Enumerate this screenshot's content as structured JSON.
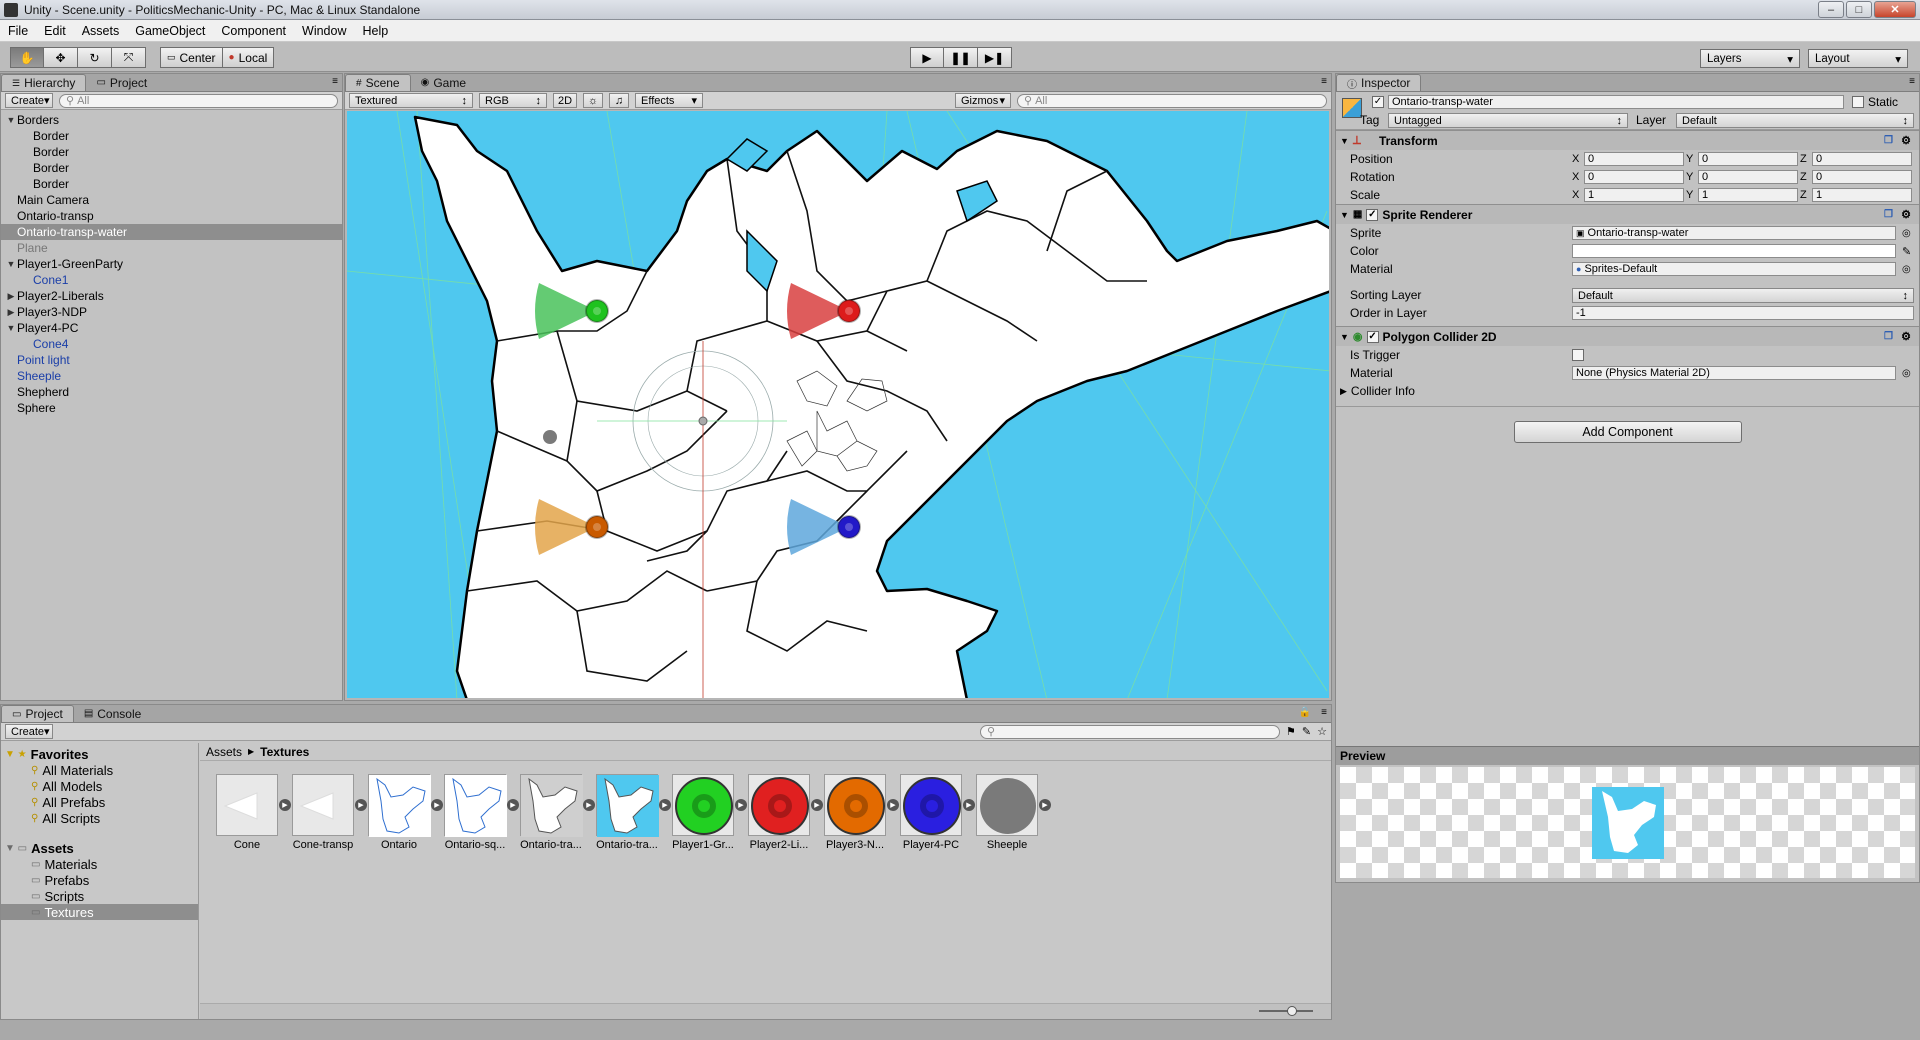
{
  "window": {
    "title": "Unity - Scene.unity - PoliticsMechanic-Unity - PC, Mac & Linux Standalone",
    "min": "–",
    "max": "□",
    "close": "✕"
  },
  "menu": [
    "File",
    "Edit",
    "Assets",
    "GameObject",
    "Component",
    "Window",
    "Help"
  ],
  "toolbar": {
    "pivot": "Center",
    "space": "Local",
    "layers": "Layers",
    "layout": "Layout"
  },
  "hierarchy": {
    "tabs": [
      "Hierarchy",
      "Project"
    ],
    "create": "Create",
    "search_placeholder": "All",
    "items": [
      {
        "label": "Borders",
        "indent": 0,
        "arrow": "▼",
        "style": ""
      },
      {
        "label": "Border",
        "indent": 1,
        "arrow": "",
        "style": ""
      },
      {
        "label": "Border",
        "indent": 1,
        "arrow": "",
        "style": ""
      },
      {
        "label": "Border",
        "indent": 1,
        "arrow": "",
        "style": ""
      },
      {
        "label": "Border",
        "indent": 1,
        "arrow": "",
        "style": ""
      },
      {
        "label": "Main Camera",
        "indent": 0,
        "arrow": "",
        "style": ""
      },
      {
        "label": "Ontario-transp",
        "indent": 0,
        "arrow": "",
        "style": ""
      },
      {
        "label": "Ontario-transp-water",
        "indent": 0,
        "arrow": "",
        "style": "sel"
      },
      {
        "label": "Plane",
        "indent": 0,
        "arrow": "",
        "style": "gray"
      },
      {
        "label": "Player1-GreenParty",
        "indent": 0,
        "arrow": "▼",
        "style": ""
      },
      {
        "label": "Cone1",
        "indent": 1,
        "arrow": "",
        "style": "blue"
      },
      {
        "label": "Player2-Liberals",
        "indent": 0,
        "arrow": "▶",
        "style": ""
      },
      {
        "label": "Player3-NDP",
        "indent": 0,
        "arrow": "▶",
        "style": ""
      },
      {
        "label": "Player4-PC",
        "indent": 0,
        "arrow": "▼",
        "style": ""
      },
      {
        "label": "Cone4",
        "indent": 1,
        "arrow": "",
        "style": "blue"
      },
      {
        "label": "Point light",
        "indent": 0,
        "arrow": "",
        "style": "blue"
      },
      {
        "label": "Sheeple",
        "indent": 0,
        "arrow": "",
        "style": "blue"
      },
      {
        "label": "Shepherd",
        "indent": 0,
        "arrow": "",
        "style": ""
      },
      {
        "label": "Sphere",
        "indent": 0,
        "arrow": "",
        "style": ""
      }
    ]
  },
  "scene": {
    "tabs": [
      "Scene",
      "Game"
    ],
    "render_mode": "Textured",
    "color_mode": "RGB",
    "mode_2d": "2D",
    "effects": "Effects",
    "gizmos": "Gizmos",
    "search_placeholder": "All",
    "water_color": "#4fc8ef"
  },
  "inspector": {
    "tab": "Inspector",
    "object_name": "Ontario-transp-water",
    "static_label": "Static",
    "tag_label": "Tag",
    "tag_value": "Untagged",
    "layer_label": "Layer",
    "layer_value": "Default",
    "transform": {
      "title": "Transform",
      "rows": [
        {
          "label": "Position",
          "x": "0",
          "y": "0",
          "z": "0"
        },
        {
          "label": "Rotation",
          "x": "0",
          "y": "0",
          "z": "0"
        },
        {
          "label": "Scale",
          "x": "1",
          "y": "1",
          "z": "1"
        }
      ]
    },
    "sprite_renderer": {
      "title": "Sprite Renderer",
      "sprite_label": "Sprite",
      "sprite_value": "Ontario-transp-water",
      "color_label": "Color",
      "material_label": "Material",
      "material_value": "Sprites-Default",
      "sorting_layer_label": "Sorting Layer",
      "sorting_layer_value": "Default",
      "order_label": "Order in Layer",
      "order_value": "-1"
    },
    "polygon_collider": {
      "title": "Polygon Collider 2D",
      "trigger_label": "Is Trigger",
      "material_label": "Material",
      "material_value": "None (Physics Material 2D)",
      "info_label": "Collider Info"
    },
    "add_component": "Add Component",
    "preview_label": "Preview"
  },
  "project": {
    "tabs": [
      "Project",
      "Console"
    ],
    "create": "Create",
    "favorites_label": "Favorites",
    "favorites": [
      "All Materials",
      "All Models",
      "All Prefabs",
      "All Scripts"
    ],
    "assets_label": "Assets",
    "folders": [
      "Materials",
      "Prefabs",
      "Scripts",
      "Textures"
    ],
    "breadcrumb": [
      "Assets",
      "Textures"
    ],
    "assets": [
      {
        "label": "Cone",
        "kind": "cone"
      },
      {
        "label": "Cone-transp",
        "kind": "cone"
      },
      {
        "label": "Ontario",
        "kind": "map"
      },
      {
        "label": "Ontario-sq...",
        "kind": "map"
      },
      {
        "label": "Ontario-tra...",
        "kind": "mapgray"
      },
      {
        "label": "Ontario-tra...",
        "kind": "mapwater"
      },
      {
        "label": "Player1-Gr...",
        "kind": "circle",
        "color": "#22d022"
      },
      {
        "label": "Player2-Li...",
        "kind": "circle",
        "color": "#e02020"
      },
      {
        "label": "Player3-N...",
        "kind": "circle",
        "color": "#e36a00"
      },
      {
        "label": "Player4-PC",
        "kind": "circle",
        "color": "#2a1fe0"
      },
      {
        "label": "Sheeple",
        "kind": "sheeple",
        "color": "#7a7a7a"
      }
    ]
  },
  "players": [
    {
      "name": "green",
      "color": "#1fc21f",
      "fan": "#49c25a"
    },
    {
      "name": "red",
      "color": "#dd1b1b",
      "fan": "#d83f3f"
    },
    {
      "name": "orange",
      "color": "#c95a00",
      "fan": "#e3a44a"
    },
    {
      "name": "blue",
      "color": "#2219c8",
      "fan": "#5ea7dc"
    }
  ]
}
